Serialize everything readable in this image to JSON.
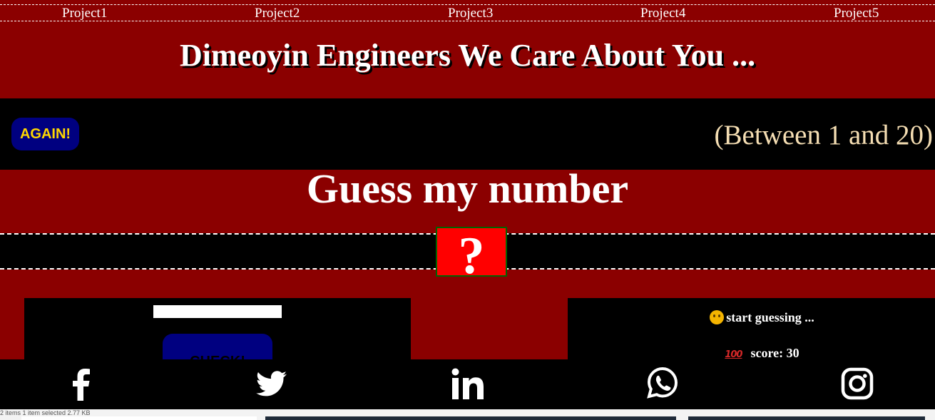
{
  "nav": {
    "links": [
      "Project1",
      "Project2",
      "Project3",
      "Project4",
      "Project5"
    ]
  },
  "header": {
    "title": "Dimeoyin Engineers We Care About You ..."
  },
  "game": {
    "again_label": "AGAIN!",
    "range_text": "(Between 1 and 20)",
    "title": "Guess my number",
    "secret": "?",
    "check_label": "CHECK!",
    "message": "start guessing ...",
    "message_icon": "thinking-face-emoji",
    "score_label": "score: 30",
    "score_icon": "hundred-points-emoji",
    "score_icon_text": "100"
  },
  "footer": {
    "icons": [
      "facebook-icon",
      "twitter-icon",
      "linkedin-icon",
      "whatsapp-icon",
      "instagram-icon"
    ]
  },
  "os": {
    "status_text": "2 items    1 item selected  2.77 KB"
  },
  "colors": {
    "background": "#8b0000",
    "bar": "#000000",
    "button": "#000080",
    "button_text": "#ffd700",
    "range_text": "#f5deb3",
    "secret_bg": "#ff0000"
  }
}
